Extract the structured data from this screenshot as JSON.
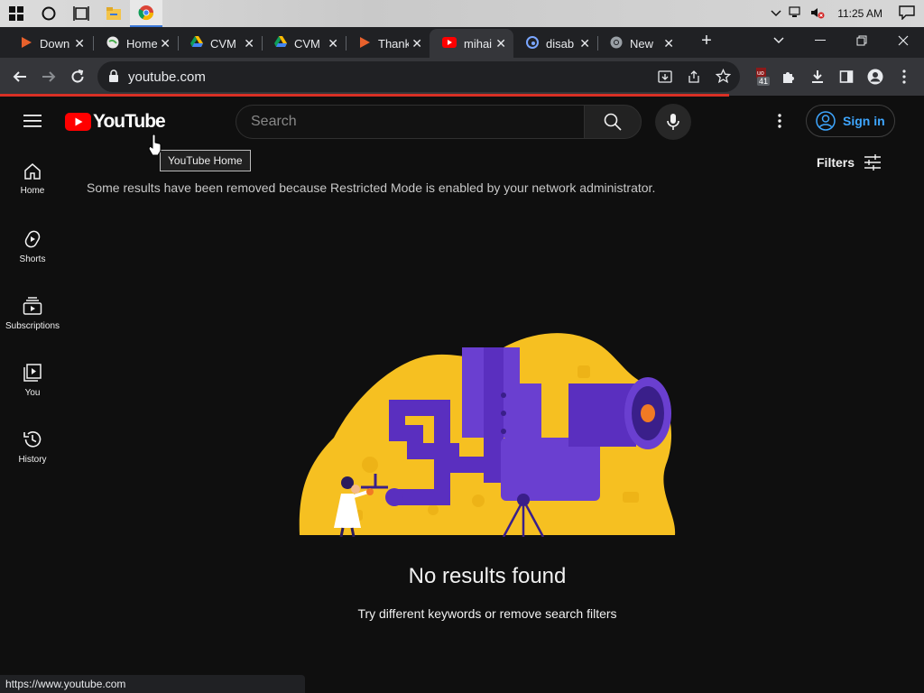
{
  "taskbar": {
    "icons": [
      "windows-start-icon",
      "cortana-search-icon",
      "task-view-icon",
      "file-explorer-icon",
      "chrome-icon"
    ],
    "clock": "11:25 AM"
  },
  "tabs": [
    {
      "title": "Down",
      "icon": "play-logo-icon",
      "active": false
    },
    {
      "title": "Home",
      "icon": "globe-icon",
      "active": false
    },
    {
      "title": "CVM",
      "icon": "google-drive-icon",
      "active": false
    },
    {
      "title": "CVM",
      "icon": "google-drive-icon",
      "active": false
    },
    {
      "title": "Thank",
      "icon": "play-logo-icon",
      "active": false
    },
    {
      "title": "mihai",
      "icon": "youtube-icon",
      "active": true
    },
    {
      "title": "disab",
      "icon": "edge-icon",
      "active": false
    },
    {
      "title": "New",
      "icon": "chrome-icon",
      "active": false
    }
  ],
  "toolbar": {
    "url": "youtube.com",
    "extension_badge": "41"
  },
  "youtube": {
    "logo_text": "YouTube",
    "search_placeholder": "Search",
    "sign_in": "Sign in",
    "tooltip": "YouTube Home",
    "restricted_notice": "Some results have been removed because Restricted Mode is enabled by your network administrator.",
    "filters": "Filters",
    "sidebar": [
      {
        "label": "Home",
        "icon": "home-icon"
      },
      {
        "label": "Shorts",
        "icon": "shorts-icon"
      },
      {
        "label": "Subscriptions",
        "icon": "subscriptions-icon"
      },
      {
        "label": "You",
        "icon": "you-library-icon"
      },
      {
        "label": "History",
        "icon": "history-icon"
      }
    ],
    "no_results_title": "No results found",
    "no_results_hint": "Try different keywords or remove search filters"
  },
  "status_url": "https://www.youtube.com",
  "colors": {
    "youtube_red": "#ff0000",
    "accent_blue": "#3ea6ff",
    "illustration_yellow": "#f6c021",
    "illustration_purple": "#6a3fd0"
  }
}
